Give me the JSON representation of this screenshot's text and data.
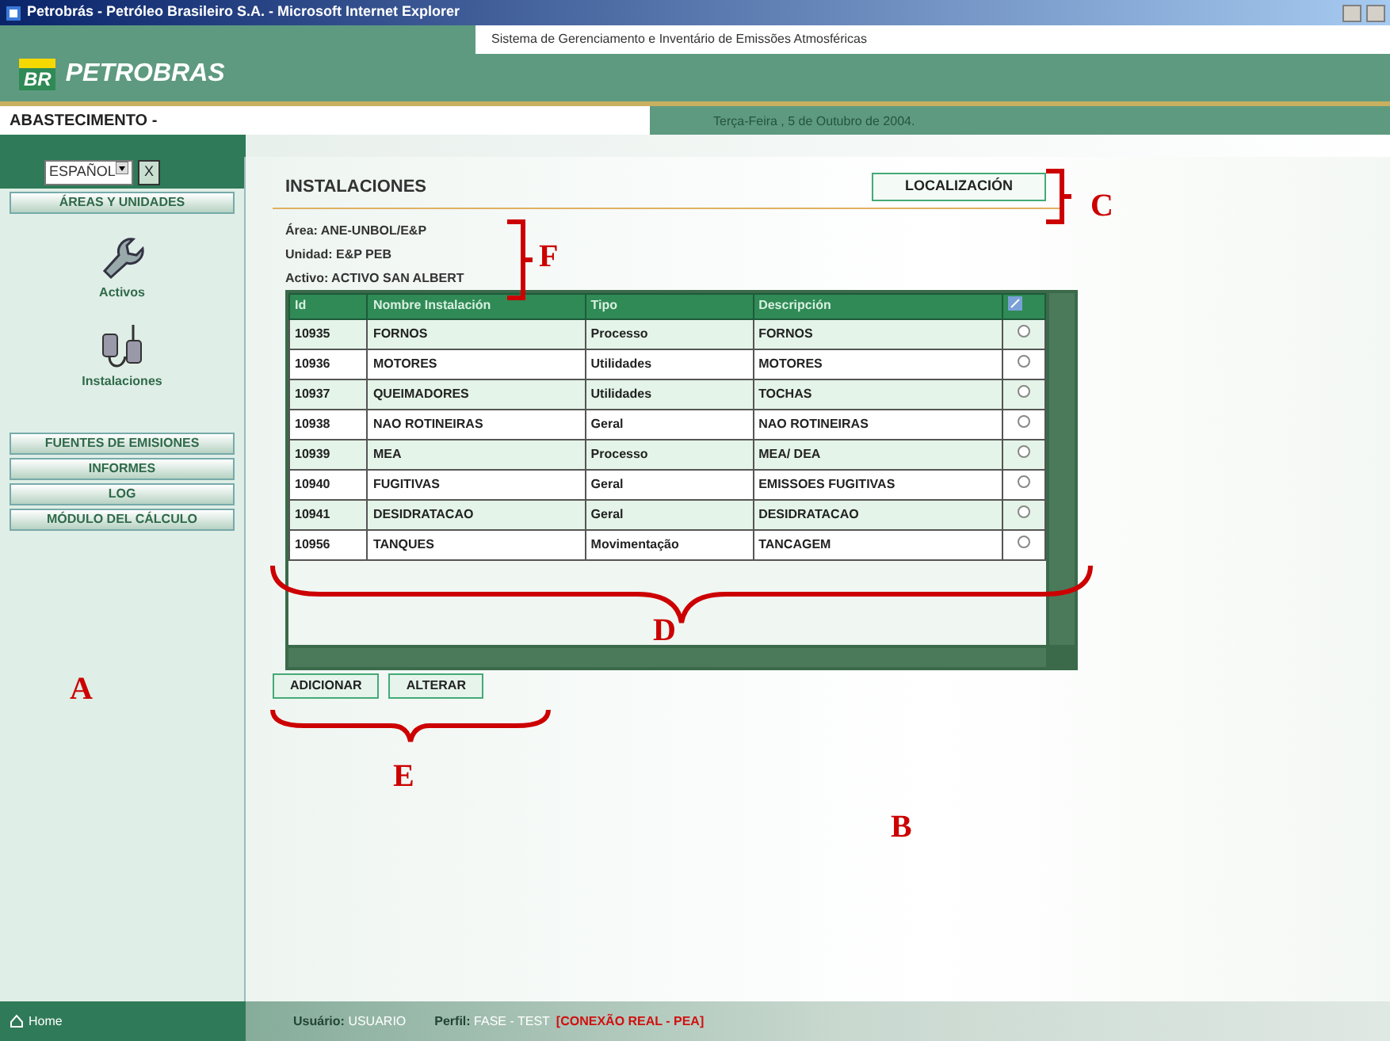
{
  "window": {
    "title": "Petrobrás - Petróleo Brasileiro S.A. - Microsoft Internet Explorer"
  },
  "header": {
    "logo_mark": "BR",
    "logo_text": "PETROBRAS",
    "system_name": "Sistema de Gerenciamento e Inventário de Emissões Atmosféricas",
    "section": "ABASTECIMENTO -",
    "date": "Terça-Feira , 5 de Outubro de 2004."
  },
  "sidebar": {
    "language": "ESPAÑOL",
    "close_label": "X",
    "group_title": "ÁREAS Y UNIDADES",
    "icons": [
      {
        "label": "Activos",
        "kind": "wrench"
      },
      {
        "label": "Instalaciones",
        "kind": "device"
      }
    ],
    "menu": [
      "FUENTES DE EMISIONES",
      "INFORMES",
      "LOG",
      "MÓDULO DEL CÁLCULO"
    ]
  },
  "main": {
    "title": "INSTALACIONES",
    "location_button": "LOCALIZACIÓN",
    "info": [
      {
        "label": "Área:",
        "value": "ANE-UNBOL/E&P"
      },
      {
        "label": "Unidad:",
        "value": "E&P PEB"
      },
      {
        "label": "Activo:",
        "value": "ACTIVO SAN ALBERT"
      }
    ],
    "table": {
      "columns": [
        "Id",
        "Nombre Instalación",
        "Tipo",
        "Descripción"
      ],
      "rows": [
        {
          "cells": [
            "10935",
            "FORNOS",
            "Processo",
            "FORNOS"
          ],
          "selected": false
        },
        {
          "cells": [
            "10936",
            "MOTORES",
            "Utilidades",
            "MOTORES"
          ],
          "selected": false
        },
        {
          "cells": [
            "10937",
            "QUEIMADORES",
            "Utilidades",
            "TOCHAS"
          ],
          "selected": false
        },
        {
          "cells": [
            "10938",
            "NAO ROTINEIRAS",
            "Geral",
            "NAO ROTINEIRAS"
          ],
          "selected": false
        },
        {
          "cells": [
            "10939",
            "MEA",
            "Processo",
            "MEA/ DEA"
          ],
          "selected": false
        },
        {
          "cells": [
            "10940",
            "FUGITIVAS",
            "Geral",
            "EMISSOES FUGITIVAS"
          ],
          "selected": false
        },
        {
          "cells": [
            "10941",
            "DESIDRATACAO",
            "Geral",
            "DESIDRATACAO"
          ],
          "selected": false
        },
        {
          "cells": [
            "10956",
            "TANQUES",
            "Movimentação",
            "TANCAGEM"
          ],
          "selected": false
        }
      ]
    },
    "buttons": [
      "ADICIONAR",
      "ALTERAR"
    ]
  },
  "status_bar": {
    "home": "Home",
    "user_label": "Usuário:",
    "user": "USUARIO",
    "profile_label": "Perfil:",
    "profile": "FASE - TEST",
    "connection": "[CONEXÃO REAL - PEA]"
  },
  "annotations": [
    {
      "label": "A"
    },
    {
      "label": "B"
    },
    {
      "label": "C"
    },
    {
      "label": "D"
    },
    {
      "label": "E"
    },
    {
      "label": "F"
    }
  ]
}
